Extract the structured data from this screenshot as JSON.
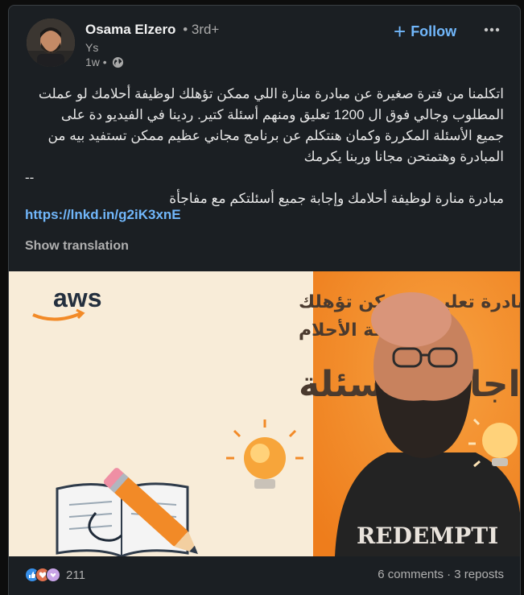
{
  "author": {
    "name": "Osama Elzero",
    "degree": "• 3rd+",
    "subtitle": "Ys",
    "time": "1w •"
  },
  "actions": {
    "follow_label": "Follow",
    "follow_icon": "plus-icon",
    "more_icon": "ellipsis-icon"
  },
  "post": {
    "lines": [
      "اتكلمنا من فترة صغيرة عن مبادرة منارة اللي ممكن تؤهلك لوظيفة أحلامك لو عملت",
      "المطلوب وجالي فوق ال 1200 تعليق ومنهم أسئلة كتير. ردينا في الفيديو دة على",
      "جميع الأسئلة المكررة وكمان هنتكلم عن برنامج مجاني عظيم ممكن تستفيد بيه من",
      "المبادرة وهتمتحن مجانا وربنا يكرمك"
    ],
    "separator": "--",
    "summary": "مبادرة منارة لوظيفة أحلامك وإجابة جميع أسئلتكم مع مفاجأة",
    "link": "https://lnkd.in/g2iK3xnE",
    "translate_label": "Show translation"
  },
  "thumbnail": {
    "brand": "aws",
    "headline_1": "مبادرة تعليمية ممكن تؤهلك",
    "headline_2": "لوظيفة الأحلام",
    "title": "اجابة الاسئلة",
    "shirt_text": "REDEMPTI",
    "colors": {
      "cream": "#f8ecd8",
      "orange": "#f28a27",
      "title": "#4a3a2e"
    }
  },
  "footer": {
    "reaction_icons": [
      "like-icon",
      "love-icon",
      "support-icon"
    ],
    "reaction_count": "211",
    "comments": "6 comments",
    "separator": " · ",
    "reposts": "3 reposts"
  }
}
